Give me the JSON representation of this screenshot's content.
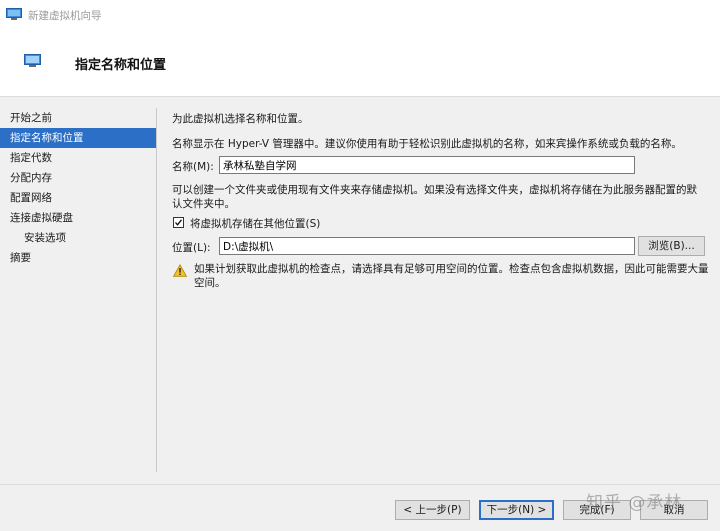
{
  "window": {
    "title": "新建虚拟机向导"
  },
  "header": {
    "title": "指定名称和位置"
  },
  "sidebar": {
    "items": [
      {
        "label": "开始之前"
      },
      {
        "label": "指定名称和位置"
      },
      {
        "label": "指定代数"
      },
      {
        "label": "分配内存"
      },
      {
        "label": "配置网络"
      },
      {
        "label": "连接虚拟硬盘"
      },
      {
        "label": "安装选项"
      },
      {
        "label": "摘要"
      }
    ]
  },
  "main": {
    "intro": "为此虚拟机选择名称和位置。",
    "name_desc": "名称显示在 Hyper-V 管理器中。建议你使用有助于轻松识别此虚拟机的名称，如来宾操作系统或负载的名称。",
    "name_label": "名称(M):",
    "name_value": "承林私塾自学网",
    "folder_desc": "可以创建一个文件夹或使用现有文件夹来存储虚拟机。如果没有选择文件夹，虚拟机将存储在为此服务器配置的默认文件夹中。",
    "store_checkbox_label": "将虚拟机存储在其他位置(S)",
    "store_checked": true,
    "location_label": "位置(L):",
    "location_value": "D:\\虚拟机\\",
    "browse_label": "浏览(B)...",
    "warning": "如果计划获取此虚拟机的检查点，请选择具有足够可用空间的位置。检查点包含虚拟机数据，因此可能需要大量空间。"
  },
  "footer": {
    "prev_label": "< 上一步(P)",
    "next_label": "下一步(N) >",
    "finish_label": "完成(F)",
    "cancel_label": "取消"
  },
  "watermark": "知乎 @承林",
  "colors": {
    "accent": "#2b6fc7",
    "panel": "#f0f0f0",
    "warning": "#f2c029"
  }
}
